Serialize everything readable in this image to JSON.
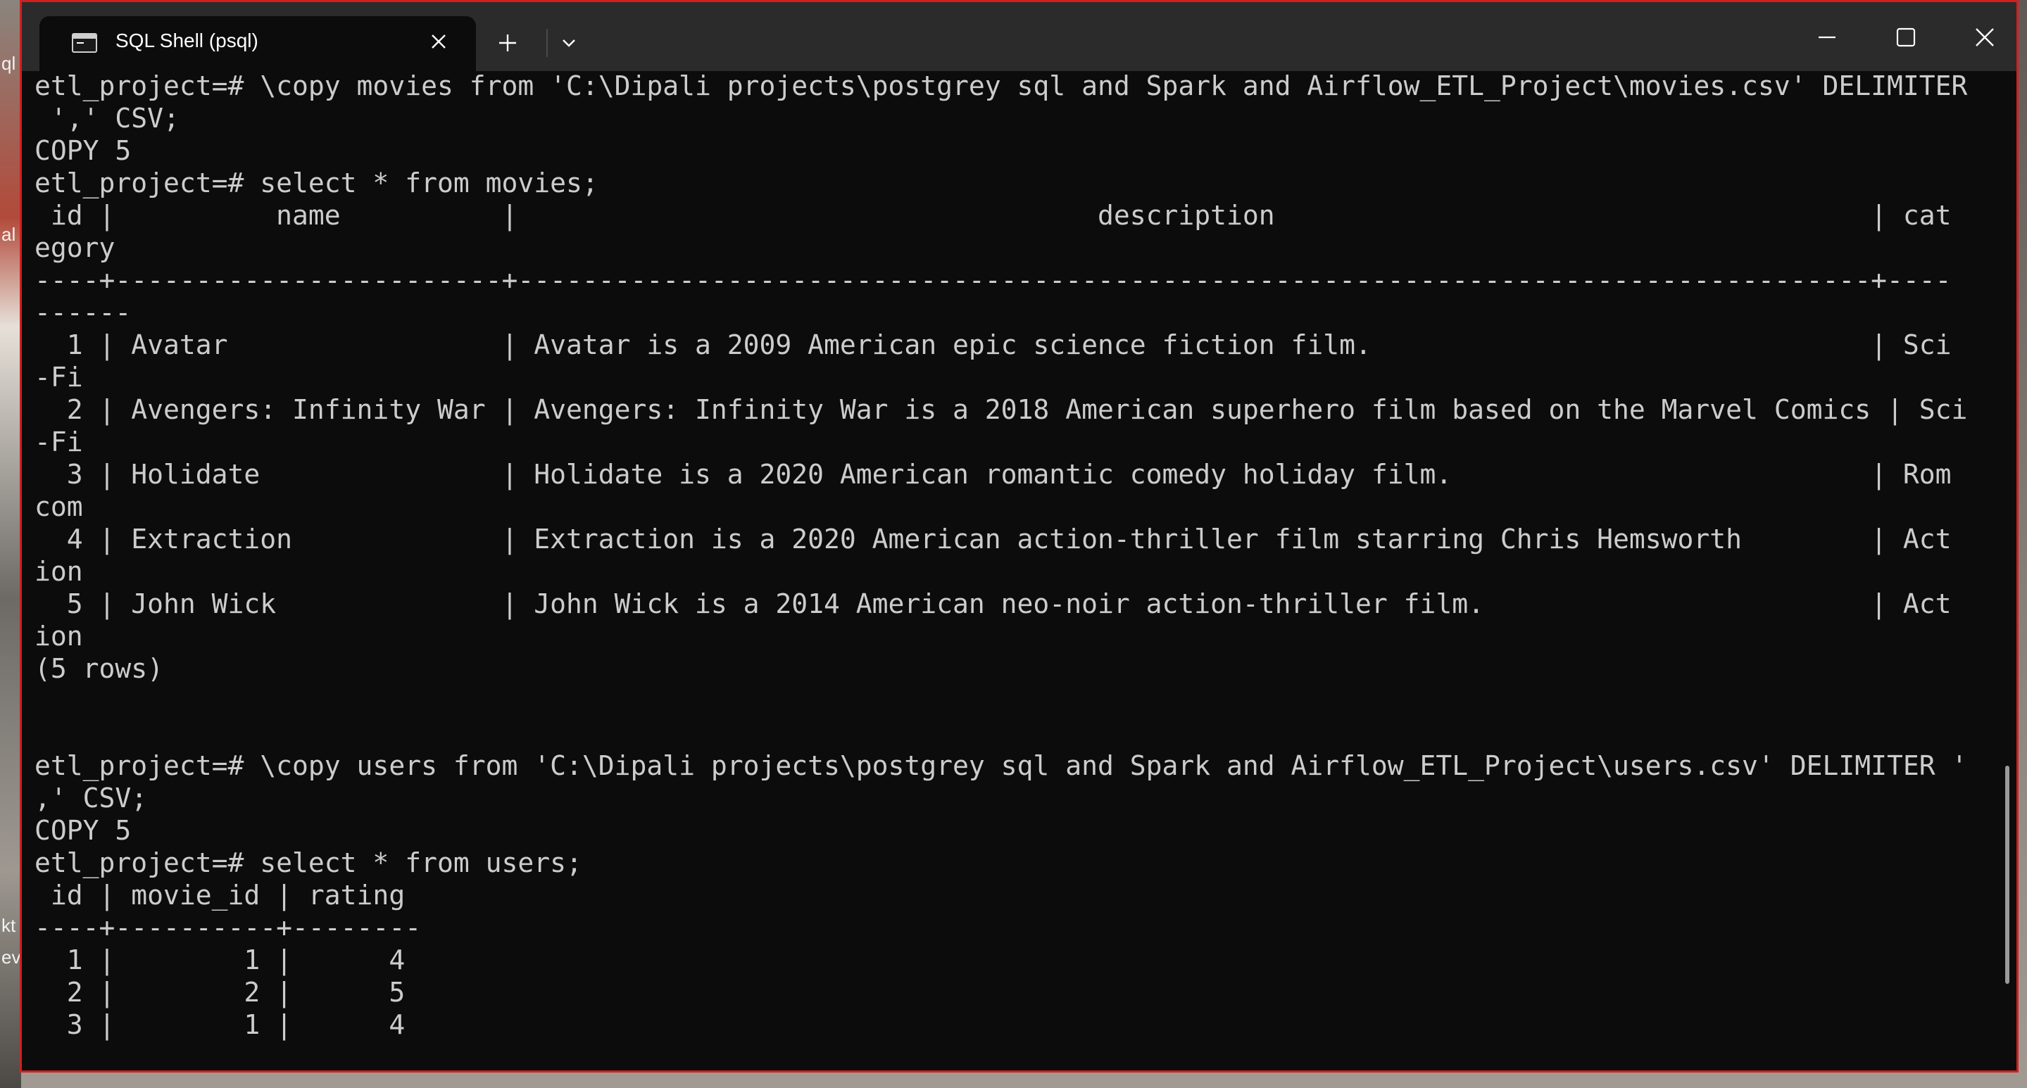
{
  "window": {
    "tab_title": "SQL Shell (psql)",
    "tab_icon": "terminal-icon",
    "controls": {
      "close_tab": "close-icon",
      "new_tab": "plus-icon",
      "dropdown": "chevron-down-icon",
      "minimize": "minimize-icon",
      "maximize": "maximize-icon",
      "close_window": "close-icon"
    },
    "border_color": "#d21f1f"
  },
  "desktop_fragments": [
    "ql",
    "al",
    "kt",
    "ev"
  ],
  "terminal": {
    "lines": [
      "etl_project=# \\copy movies from 'C:\\Dipali projects\\postgrey sql and Spark and Airflow_ETL_Project\\movies.csv' DELIMITER",
      " ',' CSV;",
      "COPY 5",
      "etl_project=# select * from movies;",
      " id |          name          |                                    description                                     | cat",
      "egory",
      "----+------------------------+------------------------------------------------------------------------------------+----",
      "------",
      "  1 | Avatar                 | Avatar is a 2009 American epic science fiction film.                               | Sci",
      "-Fi",
      "  2 | Avengers: Infinity War | Avengers: Infinity War is a 2018 American superhero film based on the Marvel Comics | Sci",
      "-Fi",
      "  3 | Holidate               | Holidate is a 2020 American romantic comedy holiday film.                          | Rom",
      "com",
      "  4 | Extraction             | Extraction is a 2020 American action-thriller film starring Chris Hemsworth        | Act",
      "ion",
      "  5 | John Wick              | John Wick is a 2014 American neo-noir action-thriller film.                        | Act",
      "ion",
      "(5 rows)",
      "",
      "",
      "etl_project=# \\copy users from 'C:\\Dipali projects\\postgrey sql and Spark and Airflow_ETL_Project\\users.csv' DELIMITER '",
      ",' CSV;",
      "COPY 5",
      "etl_project=# select * from users;",
      " id | movie_id | rating",
      "----+----------+--------",
      "  1 |        1 |      4",
      "  2 |        2 |      5",
      "  3 |        1 |      4"
    ]
  }
}
